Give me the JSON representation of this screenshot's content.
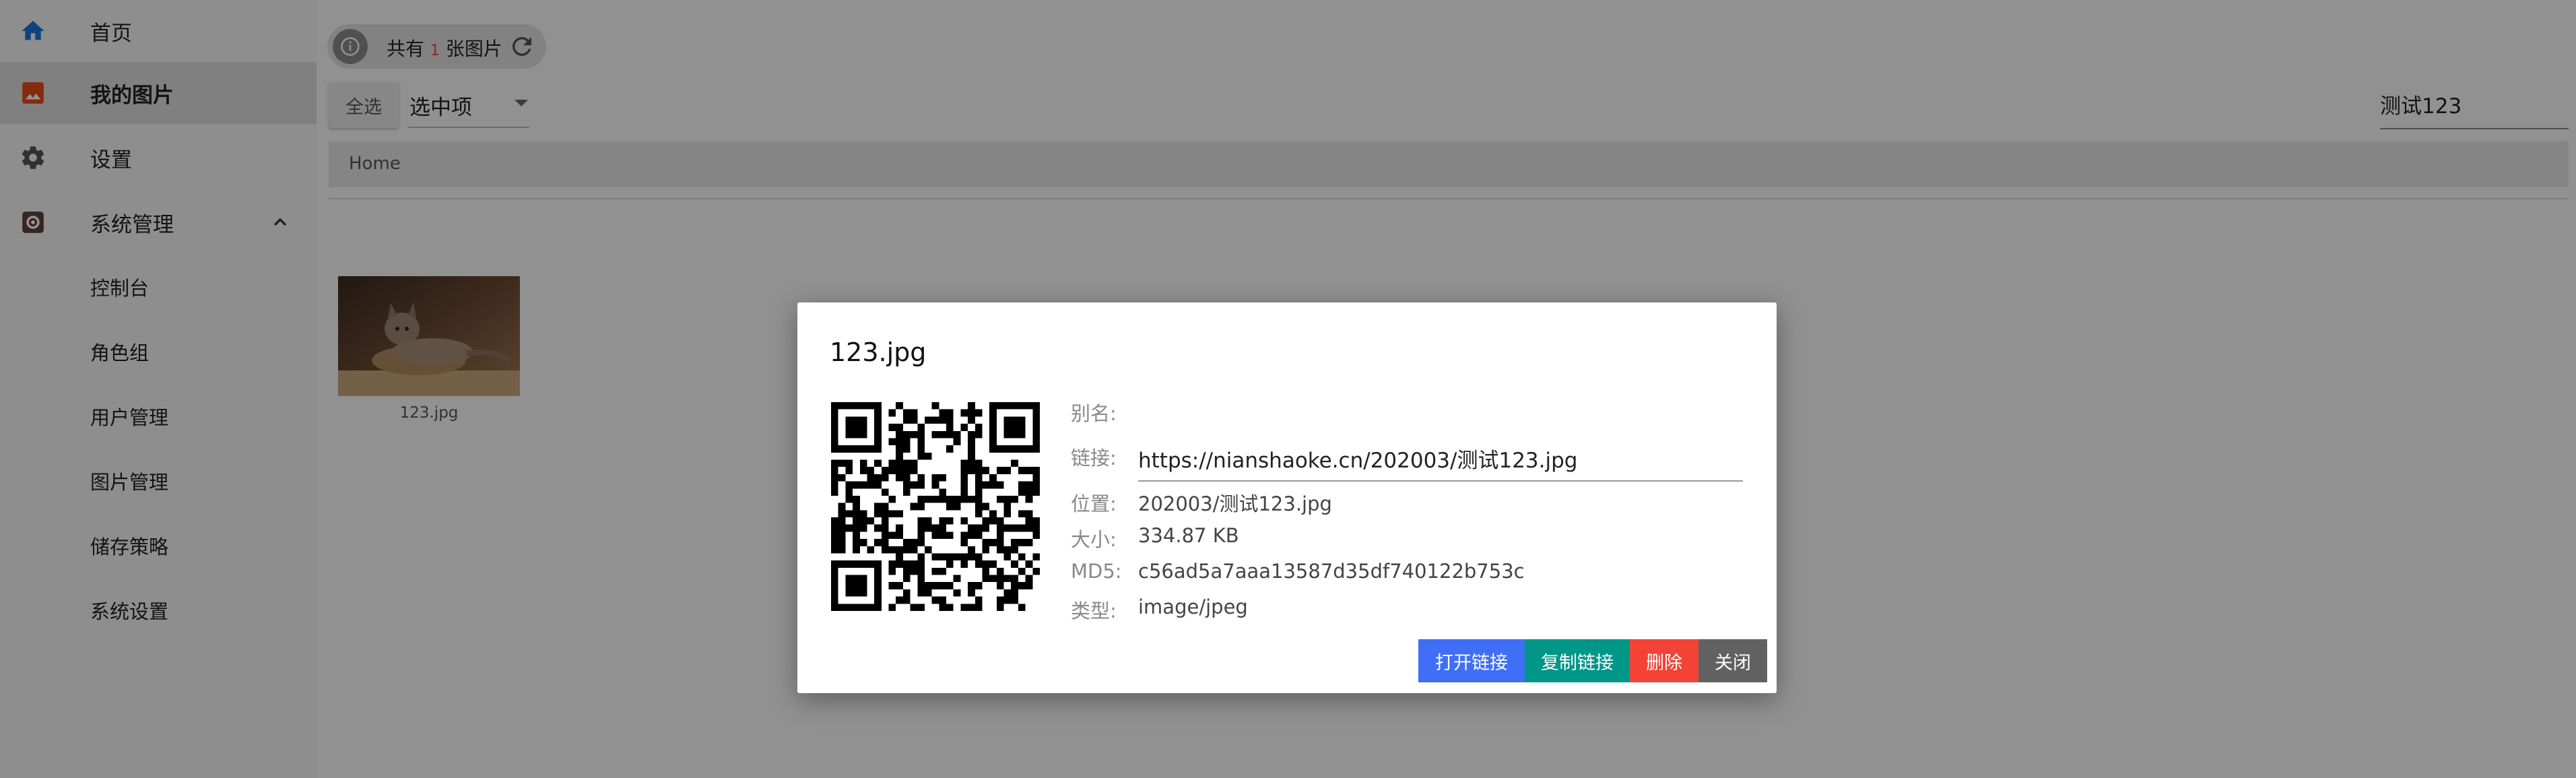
{
  "sidebar": {
    "items": [
      {
        "label": "首页"
      },
      {
        "label": "我的图片"
      },
      {
        "label": "设置"
      },
      {
        "label": "系统管理"
      }
    ],
    "sub_items": [
      {
        "label": "控制台"
      },
      {
        "label": "角色组"
      },
      {
        "label": "用户管理"
      },
      {
        "label": "图片管理"
      },
      {
        "label": "储存策略"
      },
      {
        "label": "系统设置"
      }
    ]
  },
  "toolbar": {
    "count_prefix": "共有",
    "count_value": "1",
    "count_suffix": "张图片",
    "select_all_label": "全选",
    "selected_dropdown": "选中项",
    "search_value": "测试123"
  },
  "breadcrumb": {
    "home": "Home"
  },
  "gallery": {
    "items": [
      {
        "name": "123.jpg"
      }
    ]
  },
  "dialog": {
    "title": "123.jpg",
    "alias_label": "别名:",
    "link_label": "链接:",
    "link_value": "https://nianshaoke.cn/202003/测试123.jpg",
    "location_label": "位置:",
    "location_value": "202003/测试123.jpg",
    "size_label": "大小:",
    "size_value": "334.87 KB",
    "md5_label": "MD5:",
    "md5_value": "c56ad5a7aaa13587d35df740122b753c",
    "type_label": "类型:",
    "type_value": "image/jpeg",
    "buttons": {
      "open": "打开链接",
      "copy": "复制链接",
      "delete": "删除",
      "close": "关闭"
    }
  },
  "colors": {
    "primary_blue": "#3f6ff7",
    "teal": "#009688",
    "danger_red": "#f44336",
    "neutral_grey": "#616161",
    "home_icon_blue": "#1976d2",
    "images_icon_orange": "#e64a19"
  },
  "icons": {
    "home": "home-icon",
    "images": "image-icon",
    "settings": "gear-icon",
    "system": "admin-gear-icon",
    "info": "info-icon",
    "refresh": "refresh-icon",
    "chevron": "chevron-up-icon"
  }
}
